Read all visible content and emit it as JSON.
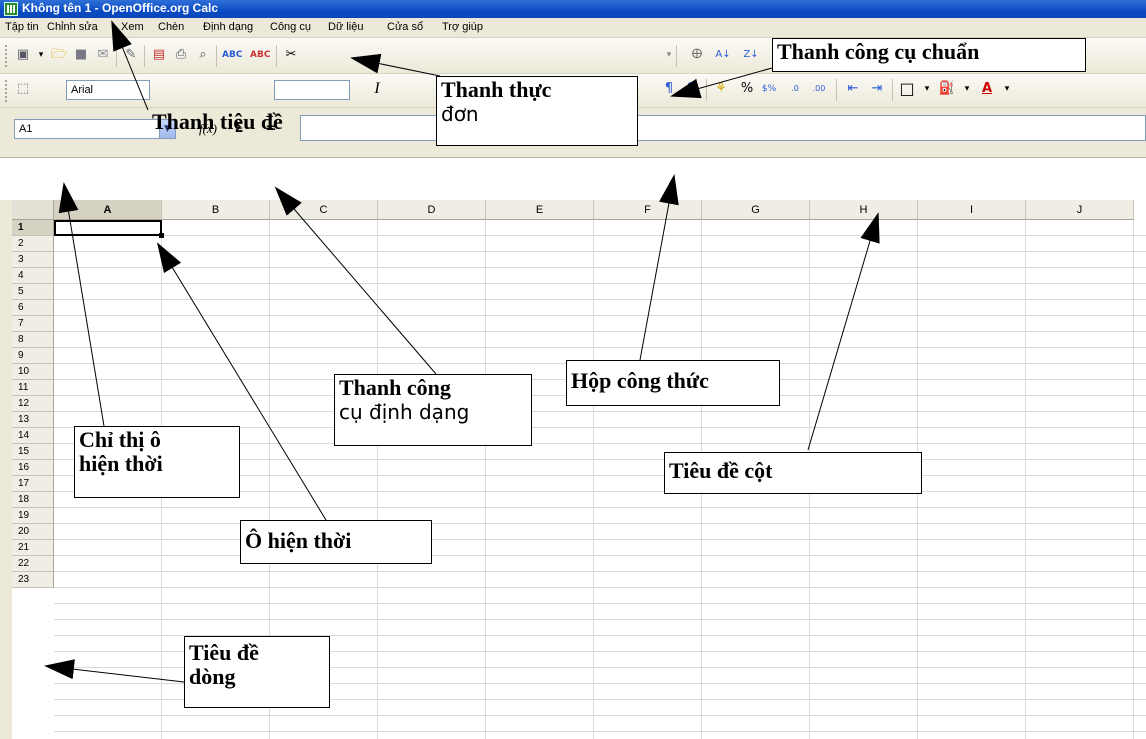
{
  "window": {
    "title": "Không tên 1 - OpenOffice.org Calc"
  },
  "menu": [
    "Tập tin",
    "Chỉnh sửa",
    "Xem",
    "Chèn",
    "Định dạng",
    "Công cụ",
    "Dữ liệu",
    "Cửa sổ",
    "Trợ giúp"
  ],
  "format_toolbar": {
    "font_name": "Arial"
  },
  "formula_bar": {
    "name_box": "A1",
    "function_wizard": "f(x)",
    "sum": "Σ",
    "equals": "="
  },
  "columns": [
    "A",
    "B",
    "C",
    "D",
    "E",
    "F",
    "G",
    "H",
    "I",
    "J"
  ],
  "rows": [
    "1",
    "2",
    "3",
    "4",
    "5",
    "6",
    "7",
    "8",
    "9",
    "10",
    "11",
    "12",
    "13",
    "14",
    "15",
    "16",
    "17",
    "18",
    "19",
    "20",
    "21",
    "22",
    "23"
  ],
  "active_cell": {
    "column": "A",
    "row": "1"
  },
  "annotations": {
    "standard_toolbar": "Thanh công cụ chuẩn",
    "menu_bar_1": "Thanh thực",
    "menu_bar_2": "đơn",
    "title_bar": "Thanh tiêu đề",
    "formatting_toolbar_1": "Thanh công",
    "formatting_toolbar_2": "cụ định dạng",
    "formula_box": "Hộp công thức",
    "cell_indicator_1": "Chỉ thị ô",
    "cell_indicator_2": "hiện thời",
    "column_header": "Tiêu đề cột",
    "current_cell": "Ô hiện thời",
    "row_header_1": "Tiêu đề",
    "row_header_2": "dòng"
  },
  "colors": {
    "titlebar": "#0b4cc4",
    "menubar": "#ece9d8",
    "grid_line": "#dadada",
    "header_bg": "#efede4"
  }
}
